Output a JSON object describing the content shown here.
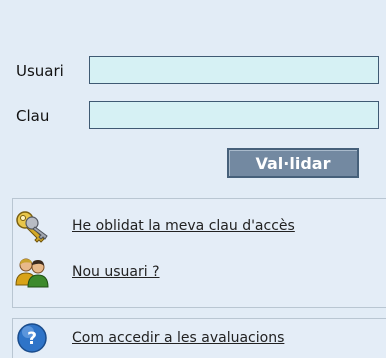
{
  "login": {
    "user_label": "Usuari",
    "password_label": "Clau",
    "user_value": "",
    "password_value": "",
    "submit_label": "Val·lidar"
  },
  "links": {
    "forgot_password": "He oblidat la meva clau d'accès",
    "new_user": "Nou usuari ?",
    "help": "Com accedir a les avaluacions"
  },
  "icons": {
    "forgot_password": "keys-icon",
    "new_user": "users-icon",
    "help": "help-icon"
  },
  "colors": {
    "panel_bg": "#e2ecf6",
    "input_bg": "#d6f1f4",
    "button_bg": "#7389a1",
    "link_text": "#222222"
  }
}
